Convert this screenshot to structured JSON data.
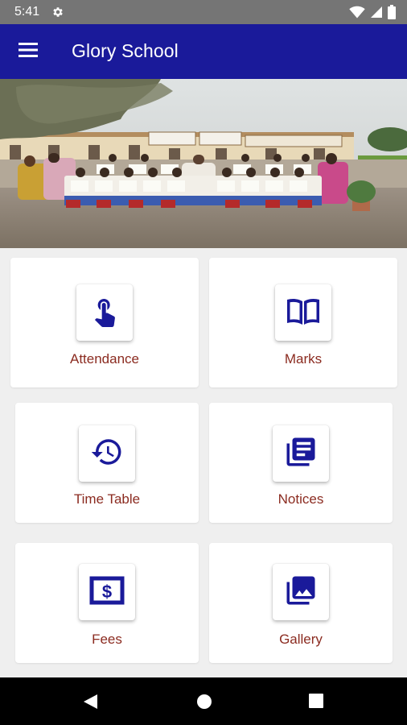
{
  "status_bar": {
    "time": "5:41",
    "icons": [
      "gear-icon",
      "wifi-icon",
      "signal-icon",
      "battery-icon"
    ]
  },
  "app_bar": {
    "title": "Glory School",
    "menu_icon": "menu-icon",
    "color": "#1a1a9a"
  },
  "menu": {
    "items": [
      {
        "label": "Attendance",
        "icon": "touch-icon"
      },
      {
        "label": "Marks",
        "icon": "book-icon"
      },
      {
        "label": "Time Table",
        "icon": "history-icon"
      },
      {
        "label": "Notices",
        "icon": "library-books-icon"
      },
      {
        "label": "Fees",
        "icon": "dollar-icon"
      },
      {
        "label": "Gallery",
        "icon": "photo-library-icon"
      }
    ],
    "icon_color": "#1a1a9a",
    "label_color": "#8b2b20"
  },
  "nav_bar": {
    "icons": [
      "back-icon",
      "home-icon",
      "recents-icon"
    ]
  }
}
